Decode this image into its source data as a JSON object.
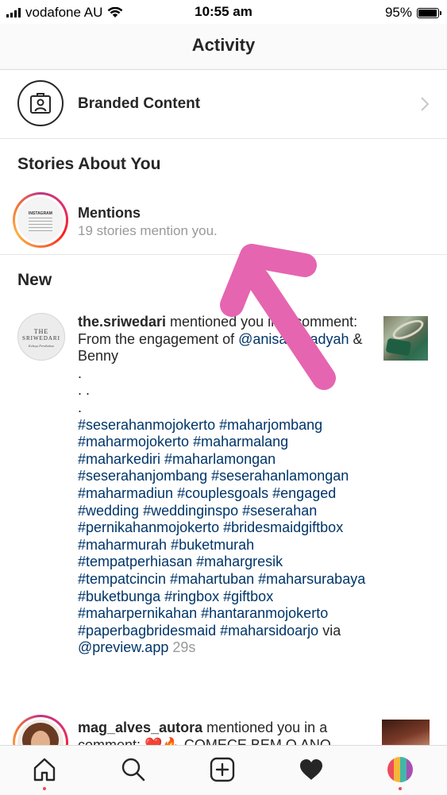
{
  "status_bar": {
    "carrier": "vodafone AU",
    "time": "10:55 am",
    "battery": "95%",
    "battery_level": 0.95
  },
  "header": {
    "title": "Activity"
  },
  "branded_content": {
    "label": "Branded Content"
  },
  "stories_section": {
    "title": "Stories About You"
  },
  "mentions": {
    "title": "Mentions",
    "subtitle": "19 stories mention you."
  },
  "new_section": {
    "title": "New"
  },
  "notification_1": {
    "username": "the.sriwedari",
    "avatar_text_1": "THE",
    "avatar_text_2": "SRIWEDARI",
    "avatar_text_3": "Kebaya Pernikahan",
    "action": " mentioned you in a comment: From the engagement of ",
    "mention": "@anisa.n.sadyah",
    "after_mention": " & Benny",
    "dots": "\n.\n. .\n.\n",
    "hashtags": "#seserahanmojokerto #maharjombang #maharmojokerto #maharmalang #maharkediri #maharlamongan #seserahanjombang #seserahanlamongan #maharmadiun #couplesgoals #engaged #wedding #weddinginspo #seserahan #pernikahanmojokerto #bridesmaidgiftbox #maharmurah #buketmurah #tempatperhiasan #mahargresik #tempatcincin #mahartuban #maharsurabaya #buketbunga #ringbox #giftbox #maharpernikahan #hantaranmojokerto #paperbagbridesmaid #maharsidoarjo",
    "via": " via ",
    "via_account": "@preview.app",
    "time": " 29s"
  },
  "notification_2": {
    "username": "mag_alves_autora",
    "action": " mentioned you in a comment: ❤️🔥 COMECE BEM O ANO"
  },
  "tab_bar": {
    "items": [
      {
        "name": "home",
        "icon": "home-icon"
      },
      {
        "name": "search",
        "icon": "search-icon"
      },
      {
        "name": "new-post",
        "icon": "plus-square-icon"
      },
      {
        "name": "activity",
        "icon": "heart-icon"
      },
      {
        "name": "profile",
        "icon": "profile-avatar"
      }
    ]
  },
  "colors": {
    "hashtag": "#003569",
    "muted": "#999999",
    "annotation_arrow": "#e565b0",
    "notification_dot": "#ed4956"
  }
}
